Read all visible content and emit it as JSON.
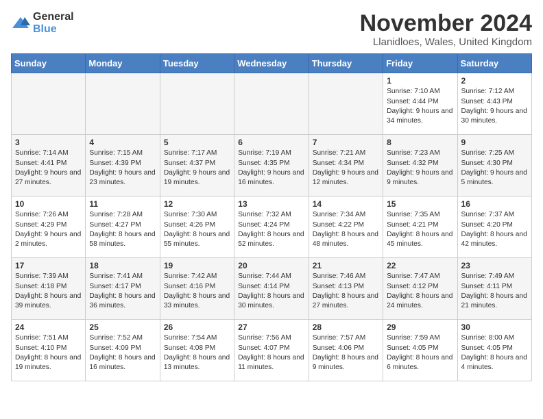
{
  "logo": {
    "general": "General",
    "blue": "Blue"
  },
  "title": "November 2024",
  "subtitle": "Llanidloes, Wales, United Kingdom",
  "days_of_week": [
    "Sunday",
    "Monday",
    "Tuesday",
    "Wednesday",
    "Thursday",
    "Friday",
    "Saturday"
  ],
  "weeks": [
    [
      {
        "day": "",
        "empty": true
      },
      {
        "day": "",
        "empty": true
      },
      {
        "day": "",
        "empty": true
      },
      {
        "day": "",
        "empty": true
      },
      {
        "day": "",
        "empty": true
      },
      {
        "day": "1",
        "sunrise": "Sunrise: 7:10 AM",
        "sunset": "Sunset: 4:44 PM",
        "daylight": "Daylight: 9 hours and 34 minutes."
      },
      {
        "day": "2",
        "sunrise": "Sunrise: 7:12 AM",
        "sunset": "Sunset: 4:43 PM",
        "daylight": "Daylight: 9 hours and 30 minutes."
      }
    ],
    [
      {
        "day": "3",
        "sunrise": "Sunrise: 7:14 AM",
        "sunset": "Sunset: 4:41 PM",
        "daylight": "Daylight: 9 hours and 27 minutes."
      },
      {
        "day": "4",
        "sunrise": "Sunrise: 7:15 AM",
        "sunset": "Sunset: 4:39 PM",
        "daylight": "Daylight: 9 hours and 23 minutes."
      },
      {
        "day": "5",
        "sunrise": "Sunrise: 7:17 AM",
        "sunset": "Sunset: 4:37 PM",
        "daylight": "Daylight: 9 hours and 19 minutes."
      },
      {
        "day": "6",
        "sunrise": "Sunrise: 7:19 AM",
        "sunset": "Sunset: 4:35 PM",
        "daylight": "Daylight: 9 hours and 16 minutes."
      },
      {
        "day": "7",
        "sunrise": "Sunrise: 7:21 AM",
        "sunset": "Sunset: 4:34 PM",
        "daylight": "Daylight: 9 hours and 12 minutes."
      },
      {
        "day": "8",
        "sunrise": "Sunrise: 7:23 AM",
        "sunset": "Sunset: 4:32 PM",
        "daylight": "Daylight: 9 hours and 9 minutes."
      },
      {
        "day": "9",
        "sunrise": "Sunrise: 7:25 AM",
        "sunset": "Sunset: 4:30 PM",
        "daylight": "Daylight: 9 hours and 5 minutes."
      }
    ],
    [
      {
        "day": "10",
        "sunrise": "Sunrise: 7:26 AM",
        "sunset": "Sunset: 4:29 PM",
        "daylight": "Daylight: 9 hours and 2 minutes."
      },
      {
        "day": "11",
        "sunrise": "Sunrise: 7:28 AM",
        "sunset": "Sunset: 4:27 PM",
        "daylight": "Daylight: 8 hours and 58 minutes."
      },
      {
        "day": "12",
        "sunrise": "Sunrise: 7:30 AM",
        "sunset": "Sunset: 4:26 PM",
        "daylight": "Daylight: 8 hours and 55 minutes."
      },
      {
        "day": "13",
        "sunrise": "Sunrise: 7:32 AM",
        "sunset": "Sunset: 4:24 PM",
        "daylight": "Daylight: 8 hours and 52 minutes."
      },
      {
        "day": "14",
        "sunrise": "Sunrise: 7:34 AM",
        "sunset": "Sunset: 4:22 PM",
        "daylight": "Daylight: 8 hours and 48 minutes."
      },
      {
        "day": "15",
        "sunrise": "Sunrise: 7:35 AM",
        "sunset": "Sunset: 4:21 PM",
        "daylight": "Daylight: 8 hours and 45 minutes."
      },
      {
        "day": "16",
        "sunrise": "Sunrise: 7:37 AM",
        "sunset": "Sunset: 4:20 PM",
        "daylight": "Daylight: 8 hours and 42 minutes."
      }
    ],
    [
      {
        "day": "17",
        "sunrise": "Sunrise: 7:39 AM",
        "sunset": "Sunset: 4:18 PM",
        "daylight": "Daylight: 8 hours and 39 minutes."
      },
      {
        "day": "18",
        "sunrise": "Sunrise: 7:41 AM",
        "sunset": "Sunset: 4:17 PM",
        "daylight": "Daylight: 8 hours and 36 minutes."
      },
      {
        "day": "19",
        "sunrise": "Sunrise: 7:42 AM",
        "sunset": "Sunset: 4:16 PM",
        "daylight": "Daylight: 8 hours and 33 minutes."
      },
      {
        "day": "20",
        "sunrise": "Sunrise: 7:44 AM",
        "sunset": "Sunset: 4:14 PM",
        "daylight": "Daylight: 8 hours and 30 minutes."
      },
      {
        "day": "21",
        "sunrise": "Sunrise: 7:46 AM",
        "sunset": "Sunset: 4:13 PM",
        "daylight": "Daylight: 8 hours and 27 minutes."
      },
      {
        "day": "22",
        "sunrise": "Sunrise: 7:47 AM",
        "sunset": "Sunset: 4:12 PM",
        "daylight": "Daylight: 8 hours and 24 minutes."
      },
      {
        "day": "23",
        "sunrise": "Sunrise: 7:49 AM",
        "sunset": "Sunset: 4:11 PM",
        "daylight": "Daylight: 8 hours and 21 minutes."
      }
    ],
    [
      {
        "day": "24",
        "sunrise": "Sunrise: 7:51 AM",
        "sunset": "Sunset: 4:10 PM",
        "daylight": "Daylight: 8 hours and 19 minutes."
      },
      {
        "day": "25",
        "sunrise": "Sunrise: 7:52 AM",
        "sunset": "Sunset: 4:09 PM",
        "daylight": "Daylight: 8 hours and 16 minutes."
      },
      {
        "day": "26",
        "sunrise": "Sunrise: 7:54 AM",
        "sunset": "Sunset: 4:08 PM",
        "daylight": "Daylight: 8 hours and 13 minutes."
      },
      {
        "day": "27",
        "sunrise": "Sunrise: 7:56 AM",
        "sunset": "Sunset: 4:07 PM",
        "daylight": "Daylight: 8 hours and 11 minutes."
      },
      {
        "day": "28",
        "sunrise": "Sunrise: 7:57 AM",
        "sunset": "Sunset: 4:06 PM",
        "daylight": "Daylight: 8 hours and 9 minutes."
      },
      {
        "day": "29",
        "sunrise": "Sunrise: 7:59 AM",
        "sunset": "Sunset: 4:05 PM",
        "daylight": "Daylight: 8 hours and 6 minutes."
      },
      {
        "day": "30",
        "sunrise": "Sunrise: 8:00 AM",
        "sunset": "Sunset: 4:05 PM",
        "daylight": "Daylight: 8 hours and 4 minutes."
      }
    ]
  ]
}
